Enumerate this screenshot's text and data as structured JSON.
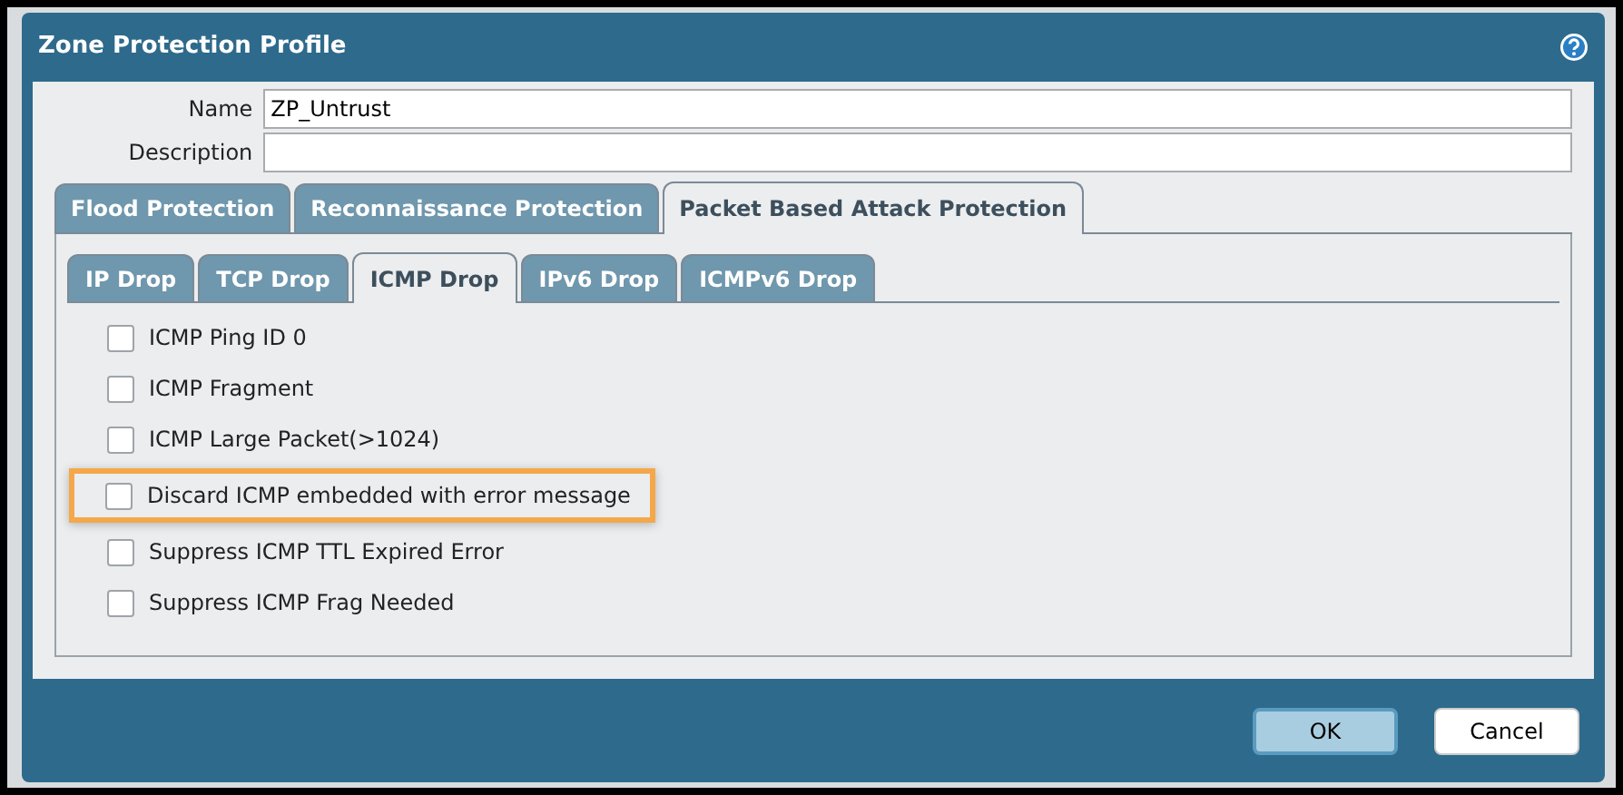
{
  "dialog": {
    "title": "Zone Protection Profile"
  },
  "fields": [
    {
      "label": "Name",
      "value": "ZP_Untrust"
    },
    {
      "label": "Description"
    }
  ],
  "tabs": [
    {
      "label": "Flood Protection",
      "selected": false
    },
    {
      "label": "Reconnaissance Protection",
      "selected": false
    },
    {
      "label": "Packet Based Attack Protection",
      "selected": true
    }
  ],
  "subtabs": [
    {
      "label": "IP Drop",
      "selected": false
    },
    {
      "label": "TCP Drop",
      "selected": false
    },
    {
      "label": "ICMP Drop",
      "selected": true
    },
    {
      "label": "IPv6 Drop",
      "selected": false
    },
    {
      "label": "ICMPv6 Drop",
      "selected": false
    }
  ],
  "options": [
    {
      "label": "ICMP Ping ID 0",
      "checked": false,
      "highlighted": false
    },
    {
      "label": "ICMP Fragment",
      "checked": false,
      "highlighted": false
    },
    {
      "label": "ICMP Large Packet(>1024)",
      "checked": false,
      "highlighted": false
    },
    {
      "label": "Discard ICMP embedded with error message",
      "checked": false,
      "highlighted": true
    },
    {
      "label": "Suppress ICMP TTL Expired Error",
      "checked": false,
      "highlighted": false
    },
    {
      "label": "Suppress ICMP Frag Needed",
      "checked": false,
      "highlighted": false
    }
  ],
  "buttons": [
    {
      "label": "OK",
      "kind": "primary"
    },
    {
      "label": "Cancel",
      "kind": "secondary"
    }
  ]
}
